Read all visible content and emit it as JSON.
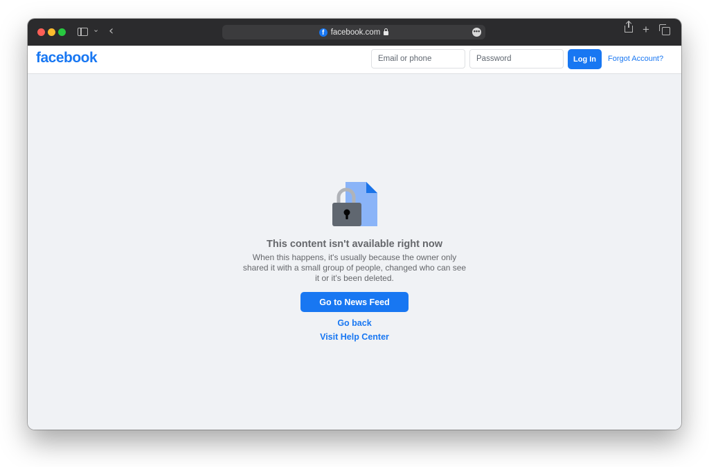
{
  "browser": {
    "url": "facebook.com",
    "favicon_letter": "f",
    "more_glyph": "•••",
    "icons": [
      "sidebar-icon",
      "chevron-down-icon",
      "back-icon",
      "lock-icon",
      "more-icon",
      "share-icon",
      "plus-icon",
      "tabs-icon"
    ]
  },
  "header": {
    "logo": "facebook",
    "email_placeholder": "Email or phone",
    "password_placeholder": "Password",
    "login_label": "Log In",
    "forgot_label": "Forgot Account?"
  },
  "main": {
    "title": "This content isn't available right now",
    "description": "When this happens, it's usually because the owner only shared it with a small group of people, changed who can see it or it's been deleted.",
    "primary_button": "Go to News Feed",
    "go_back": "Go back",
    "help_center": "Visit Help Center"
  },
  "colors": {
    "brand": "#1877f2",
    "background": "#f0f2f5",
    "text_secondary": "#65676b",
    "titlebar": "#2b2b2d"
  }
}
